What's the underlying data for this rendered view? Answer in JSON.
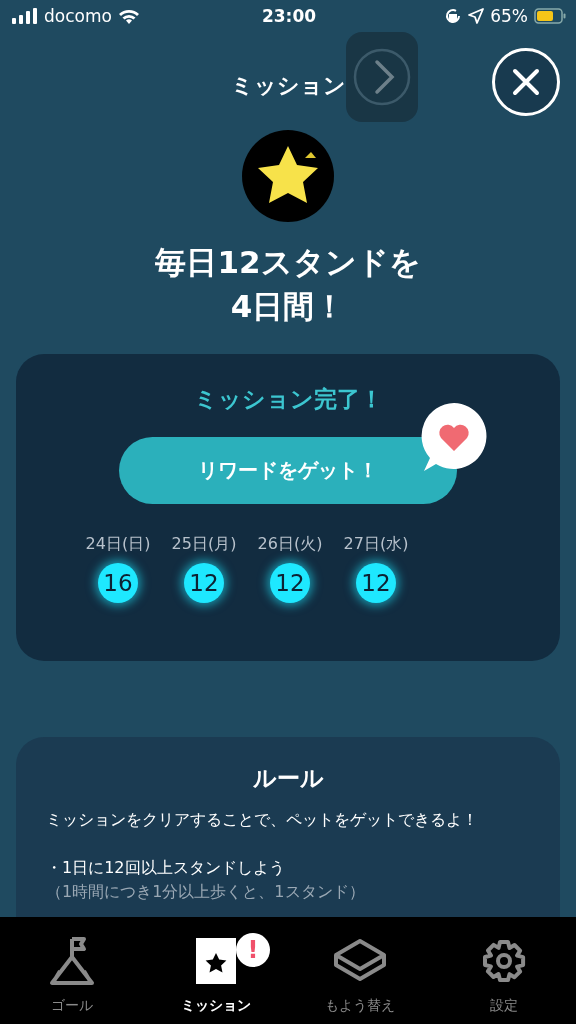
{
  "status_bar": {
    "carrier": "docomo",
    "time": "23:00",
    "battery": "65%"
  },
  "header": {
    "title": "ミッション"
  },
  "mission": {
    "headline": [
      "毎日12スタンドを",
      "4日間！"
    ]
  },
  "progress_card": {
    "status": "ミッション完了！",
    "reward_button": "リワードをゲット！",
    "days": [
      {
        "label": "24日(日)",
        "count": "16"
      },
      {
        "label": "25日(月)",
        "count": "12"
      },
      {
        "label": "26日(火)",
        "count": "12"
      },
      {
        "label": "27日(水)",
        "count": "12"
      }
    ]
  },
  "rules": {
    "title": "ルール",
    "lines": [
      "ミッションをクリアすることで、ペットをゲットできるよ！",
      "・1日に12回以上スタンドしよう",
      "（1時間につき1分以上歩くと、1スタンド）"
    ]
  },
  "tabs": [
    {
      "label": "ゴール",
      "kind": "goal",
      "selected": false
    },
    {
      "label": "ミッション",
      "kind": "mission",
      "selected": true,
      "badge": "!"
    },
    {
      "label": "もよう替え",
      "kind": "decor",
      "selected": false
    },
    {
      "label": "設定",
      "kind": "settings",
      "selected": false
    }
  ]
}
